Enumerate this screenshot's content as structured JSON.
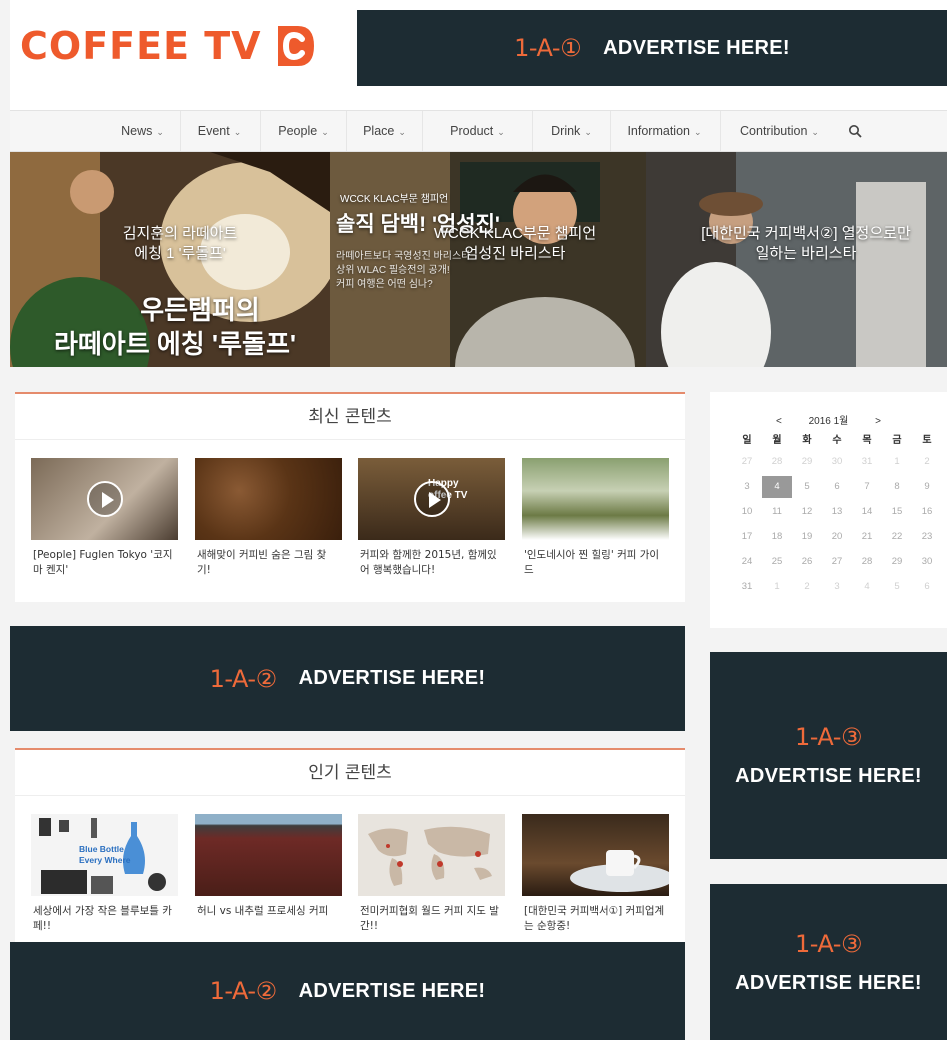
{
  "brand": {
    "name": "COFFEE TV",
    "accent": "#ee5a2c",
    "ad_bg": "#1d2c33",
    "ad_accent": "#ee6a3a"
  },
  "ads": {
    "top": {
      "code": "1-A-①",
      "text": "ADVERTISE HERE!"
    },
    "mid": {
      "code": "1-A-②",
      "text": "ADVERTISE HERE!"
    },
    "bottom": {
      "code": "1-A-②",
      "text": "ADVERTISE HERE!"
    },
    "side1": {
      "code": "1-A-③",
      "text": "ADVERTISE HERE!"
    },
    "side2": {
      "code": "1-A-③",
      "text": "ADVERTISE HERE!"
    }
  },
  "nav": {
    "items": [
      {
        "label": "News"
      },
      {
        "label": "Event"
      },
      {
        "label": "People"
      },
      {
        "label": "Place"
      },
      {
        "label": "Product"
      },
      {
        "label": "Drink"
      },
      {
        "label": "Information"
      },
      {
        "label": "Contribution"
      }
    ],
    "search_icon": "search-icon"
  },
  "hero": [
    {
      "caption_small": "김지훈의 라떼아트\n에칭 1 '루돌프'",
      "caption_big_1": "우든탬퍼의",
      "caption_big_2": "라떼아트 에칭 '루돌프'"
    },
    {
      "kicker": "WCCK KLAC부문 챔피언",
      "title": "솔직 담백! '엄성진'",
      "caption": "WCCK KLAC부문 챔피언\n엄성진 바리스타",
      "sub": "라떼아트보다 국영성진 바리스타\n상위 WLAC 필승전의 공개!\n커피 여행은 어떤 심나?"
    },
    {
      "caption": "[대한민국 커피백서②] 열정으로만\n일하는 바리스타"
    }
  ],
  "latest": {
    "title": "최신 콘텐츠",
    "items": [
      {
        "caption": "[People] Fuglen Tokyo '코지마 켄지'",
        "video": true
      },
      {
        "caption": "새해맞이 커피빈 숨은 그림 찾기!",
        "video": false
      },
      {
        "caption": "커피와 함께한 2015년, 함께있어 행복했습니다!",
        "video": true,
        "overlay": "Happy\noffee TV"
      },
      {
        "caption": "'인도네시아 찐 힐링' 커피 가이드",
        "video": false
      }
    ]
  },
  "popular": {
    "title": "인기 콘텐츠",
    "items": [
      {
        "caption": "세상에서 가장 작은 블루보틀 카페!!",
        "overlay": "Blue Bottle\nEvery Where"
      },
      {
        "caption": "허니 vs 내추럴 프로세싱 커피"
      },
      {
        "caption": "전미커피협회 월드 커피 지도 발간!!"
      },
      {
        "caption": "[대한민국 커피백서①] 커피업계는 순항중!"
      }
    ]
  },
  "calendar": {
    "prev": "<",
    "month_label": "2016 1월",
    "next": ">",
    "weekdays": [
      "일",
      "월",
      "화",
      "수",
      "목",
      "금",
      "토"
    ],
    "weeks": [
      [
        "27",
        "28",
        "29",
        "30",
        "31",
        "1",
        "2"
      ],
      [
        "3",
        "4",
        "5",
        "6",
        "7",
        "8",
        "9"
      ],
      [
        "10",
        "11",
        "12",
        "13",
        "14",
        "15",
        "16"
      ],
      [
        "17",
        "18",
        "19",
        "20",
        "21",
        "22",
        "23"
      ],
      [
        "24",
        "25",
        "26",
        "27",
        "28",
        "29",
        "30"
      ],
      [
        "31",
        "1",
        "2",
        "3",
        "4",
        "5",
        "6"
      ]
    ],
    "today": "4"
  }
}
